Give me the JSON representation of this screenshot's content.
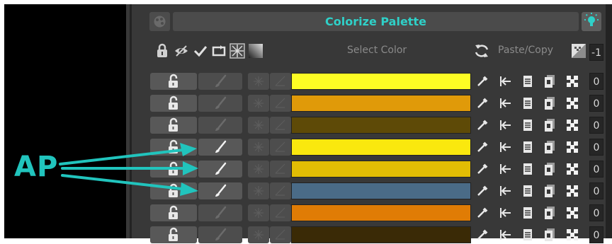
{
  "header": {
    "title": "Colorize Palette",
    "select_color": "Select Color",
    "paste_copy": "Paste/Copy",
    "index_value": "-1"
  },
  "annotation": {
    "label": "AP"
  },
  "icons": {
    "lock": "lock-icon",
    "eye": "eye-icon",
    "check": "check-icon",
    "swap": "swap-icon",
    "sparkle": "sparkle-icon",
    "gradient": "gradient-icon",
    "refresh": "refresh-icon",
    "checker": "checker-icon",
    "bulb": "lightbulb-icon",
    "unlock": "unlock-icon",
    "brush": "brush-icon",
    "eyedropper": "eyedropper-icon",
    "arrow_left_bar": "arrow-left-bar-icon",
    "paste": "paste-icon",
    "copy": "copy-icon",
    "shuffle": "shuffle-icon"
  },
  "colors": {
    "accent": "#2fd0c8",
    "panel": "#383838",
    "button": "#585858"
  },
  "rows": [
    {
      "color": "#fdfd24",
      "brush_active": false,
      "index": "0"
    },
    {
      "color": "#e09a09",
      "brush_active": false,
      "index": "0"
    },
    {
      "color": "#5e4a07",
      "brush_active": false,
      "index": "0"
    },
    {
      "color": "#fae80e",
      "brush_active": true,
      "index": "0"
    },
    {
      "color": "#e2bd04",
      "brush_active": true,
      "index": "0"
    },
    {
      "color": "#4a6b87",
      "brush_active": true,
      "index": "0"
    },
    {
      "color": "#e07c05",
      "brush_active": false,
      "index": "0"
    },
    {
      "color": "#3a2a06",
      "brush_active": false,
      "index": "0"
    }
  ]
}
